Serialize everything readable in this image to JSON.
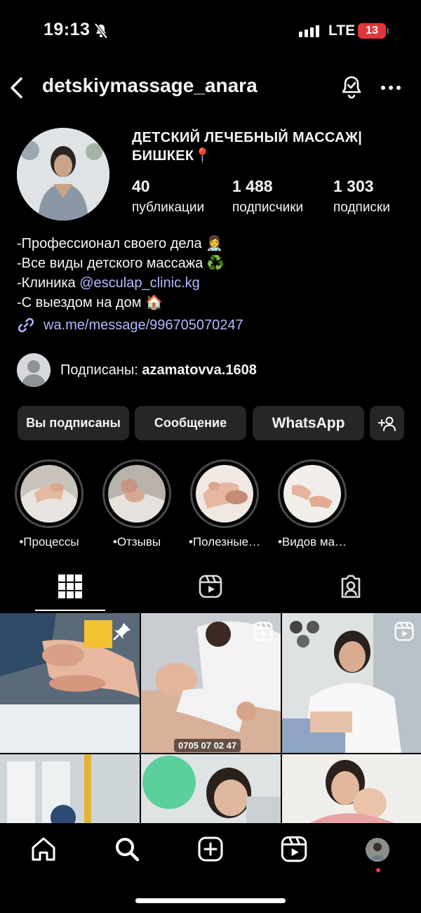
{
  "status_bar": {
    "time": "19:13",
    "network": "LTE",
    "battery": "13"
  },
  "header": {
    "username": "detskiymassage_anara"
  },
  "profile": {
    "display_name": "ДЕТСКИЙ ЛЕЧЕБНЫЙ МАССАЖ| БИШКЕК📍",
    "stats": [
      {
        "value": "40",
        "label": "публикации"
      },
      {
        "value": "1 488",
        "label": "подписчики"
      },
      {
        "value": "1 303",
        "label": "подписки"
      }
    ],
    "bio": {
      "line1": "-Профессионал своего дела 👩‍⚕️",
      "line2": "-Все виды детского  массажа ♻️",
      "line3_prefix": "-Клиника ",
      "line3_mention": "@esculap_clinic.kg",
      "line4": "-С выездом на дом 🏠"
    },
    "link": "wa.me/message/996705070247",
    "followed_by_prefix": "Подписаны: ",
    "followed_by_user": "azamatovva.1608"
  },
  "buttons": {
    "following": "Вы подписаны",
    "message": "Сообщение",
    "whatsapp": "WhatsApp"
  },
  "highlights": [
    {
      "label": "•Процессы"
    },
    {
      "label": "•Отзывы"
    },
    {
      "label": "•Полезные…"
    },
    {
      "label": "•Видов ма…"
    }
  ],
  "tabs": [
    "grid-icon",
    "reels-icon",
    "tagged-icon"
  ],
  "grid": {
    "phone_overlay": "0705 07 02 47"
  },
  "nav": [
    "home-icon",
    "search-icon",
    "create-icon",
    "reels-icon",
    "profile-avatar"
  ],
  "colors": {
    "link": "#b4b8ff",
    "button_bg": "#262626",
    "background": "#000000",
    "notification_dot": "#ff3040"
  }
}
